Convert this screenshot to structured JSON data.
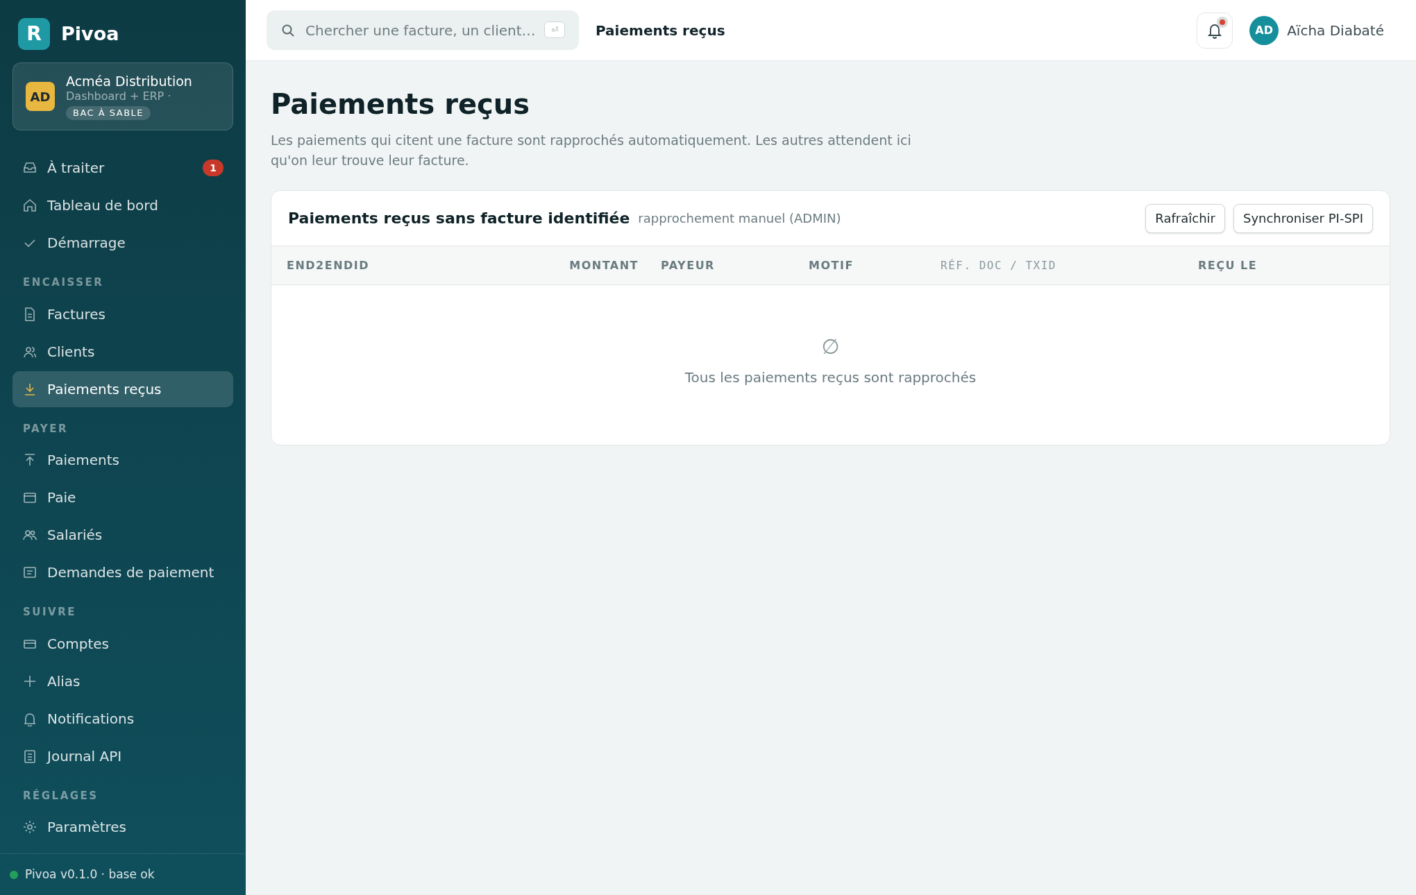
{
  "brand": {
    "logo_letter": "R",
    "name": "Pivoa"
  },
  "org": {
    "initials": "AD",
    "name": "Acméa Distribution",
    "plan": "Dashboard + ERP ·",
    "badge": "BAC À SABLE"
  },
  "sidebar": {
    "sections": [
      {
        "items": [
          {
            "kind": "inbox",
            "label": "À traiter",
            "badge": "1",
            "selected": false
          },
          {
            "kind": "home",
            "label": "Tableau de bord",
            "selected": false
          },
          {
            "kind": "check",
            "label": "Démarrage",
            "selected": false
          }
        ]
      },
      {
        "title": "ENCAISSER",
        "items": [
          {
            "kind": "file",
            "label": "Factures",
            "selected": false
          },
          {
            "kind": "users",
            "label": "Clients",
            "selected": false
          },
          {
            "kind": "download",
            "label": "Paiements reçus",
            "selected": true
          }
        ]
      },
      {
        "title": "PAYER",
        "items": [
          {
            "kind": "upload",
            "label": "Paiements",
            "selected": false
          },
          {
            "kind": "wallet",
            "label": "Paie",
            "selected": false
          },
          {
            "kind": "people",
            "label": "Salariés",
            "selected": false
          },
          {
            "kind": "list",
            "label": "Demandes de paiement",
            "selected": false
          }
        ]
      },
      {
        "title": "SUIVRE",
        "items": [
          {
            "kind": "card",
            "label": "Comptes",
            "selected": false
          },
          {
            "kind": "plus",
            "label": "Alias",
            "selected": false
          },
          {
            "kind": "bell",
            "label": "Notifications",
            "selected": false
          },
          {
            "kind": "doc",
            "label": "Journal API",
            "selected": false
          }
        ]
      },
      {
        "title": "RÉGLAGES",
        "items": [
          {
            "kind": "sun",
            "label": "Paramètres",
            "selected": false
          }
        ]
      }
    ]
  },
  "status": {
    "text": "Pivoa v0.1.0 · base ok",
    "color": "#22a05a"
  },
  "topbar": {
    "search": {
      "placeholder": "Chercher une facture, un client…",
      "key": "⏎"
    },
    "page": "Paiements reçus",
    "notifications_unread": true,
    "user": {
      "initials": "AD",
      "name": "Aïcha Diabaté"
    }
  },
  "page": {
    "title": "Paiements reçus",
    "description": "Les paiements qui citent une facture sont rapprochés automatiquement. Les autres attendent ici qu'on leur trouve leur facture."
  },
  "card": {
    "title": "Paiements reçus sans facture identifiée",
    "subtitle": "rapprochement manuel (ADMIN)",
    "buttons": [
      "Rafraîchir",
      "Synchroniser PI-SPI"
    ],
    "table": {
      "columns": [
        {
          "label": "END2ENDID",
          "kind": "text"
        },
        {
          "label": "MONTANT",
          "kind": "amount"
        },
        {
          "label": "PAYEUR",
          "kind": "text"
        },
        {
          "label": "MOTIF",
          "kind": "text"
        },
        {
          "label": "RÉF. DOC / TXID",
          "kind": "mono"
        },
        {
          "label": "REÇU LE",
          "kind": "text"
        }
      ],
      "empty": {
        "icon": "∅",
        "text": "Tous les paiements reçus sont rapprochés"
      }
    }
  }
}
